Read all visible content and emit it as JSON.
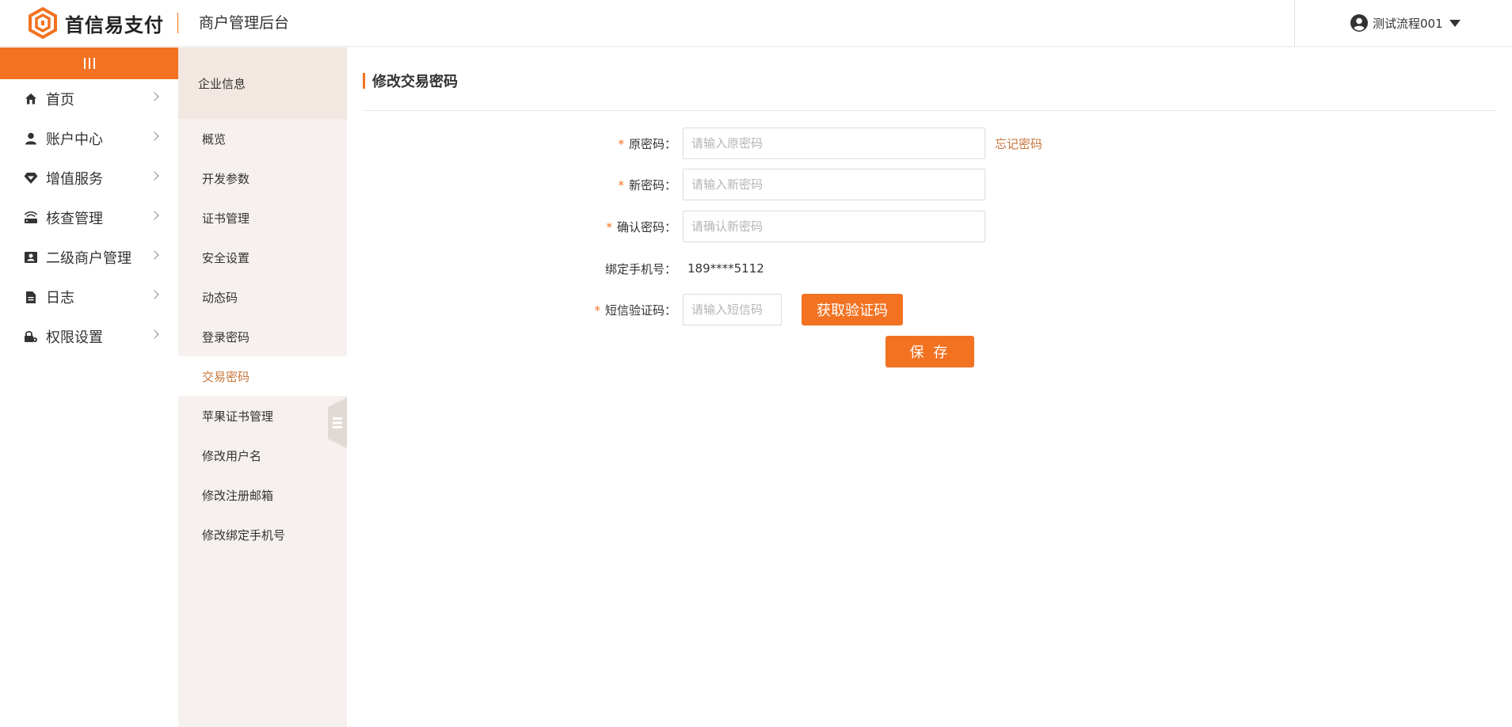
{
  "header": {
    "brand": "首信易支付",
    "subtitle": "商户管理后台",
    "user": "测试流程001",
    "brand_color": "#f27221"
  },
  "sidebar": {
    "toggle_icon": "menu-bars-icon",
    "items": [
      {
        "label": "首页",
        "icon": "home-icon"
      },
      {
        "label": "账户中心",
        "icon": "user-icon"
      },
      {
        "label": "增值服务",
        "icon": "diamond-icon"
      },
      {
        "label": "核查管理",
        "icon": "router-icon"
      },
      {
        "label": "二级商户管理",
        "icon": "id-card-icon"
      },
      {
        "label": "日志",
        "icon": "document-icon"
      },
      {
        "label": "权限设置",
        "icon": "lock-gear-icon"
      }
    ]
  },
  "subnav": {
    "heading": "企业信息",
    "items": [
      {
        "label": "概览"
      },
      {
        "label": "开发参数"
      },
      {
        "label": "证书管理"
      },
      {
        "label": "安全设置"
      },
      {
        "label": "动态码"
      },
      {
        "label": "登录密码"
      },
      {
        "label": "交易密码",
        "active": true
      },
      {
        "label": "苹果证书管理"
      },
      {
        "label": "修改用户名"
      },
      {
        "label": "修改注册邮箱"
      },
      {
        "label": "修改绑定手机号"
      }
    ],
    "active_color": "#c8753a"
  },
  "main": {
    "title": "修改交易密码",
    "form": {
      "old_password": {
        "label": "原密码：",
        "placeholder": "请输入原密码",
        "value": ""
      },
      "forgot_link": "忘记密码",
      "new_password": {
        "label": "新密码：",
        "placeholder": "请输入新密码",
        "value": ""
      },
      "confirm_password": {
        "label": "确认密码：",
        "placeholder": "请确认新密码",
        "value": ""
      },
      "bound_phone": {
        "label": "绑定手机号：",
        "value": "189****5112"
      },
      "sms_code": {
        "label": "短信验证码：",
        "placeholder": "请输入短信码",
        "value": ""
      },
      "get_code_button": "获取验证码",
      "save_button": "保 存"
    }
  }
}
